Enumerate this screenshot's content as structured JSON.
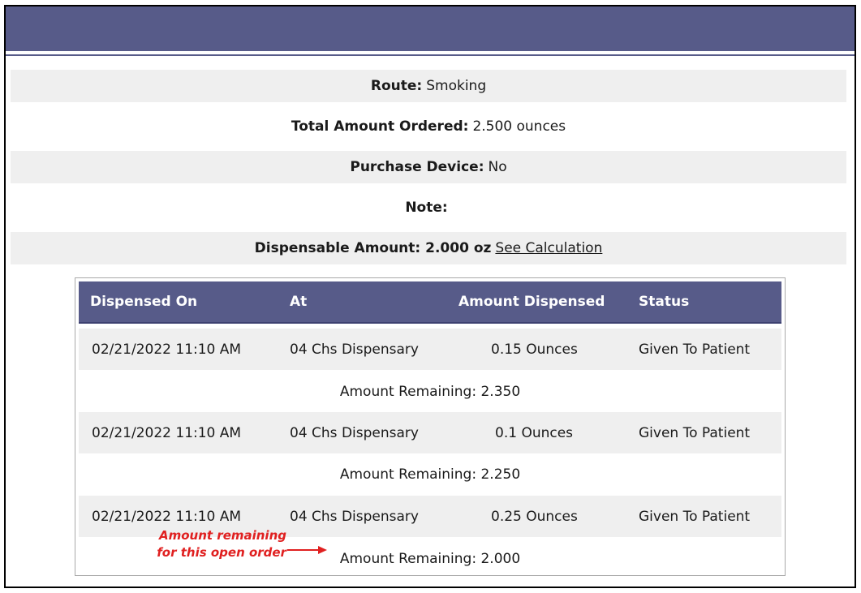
{
  "details": {
    "route_label": "Route:",
    "route_value": "Smoking",
    "total_label": "Total Amount Ordered:",
    "total_value": "2.500 ounces",
    "device_label": "Purchase Device:",
    "device_value": "No",
    "note_label": "Note:",
    "note_value": "",
    "dispensable_text": "Dispensable Amount: 2.000 oz",
    "see_calc_link": "See Calculation"
  },
  "table": {
    "headers": [
      "Dispensed On",
      "At",
      "Amount Dispensed",
      "Status"
    ],
    "rows": [
      {
        "dispensed_on": "02/21/2022 11:10 AM",
        "at": "04 Chs Dispensary",
        "amount": "0.15 Ounces",
        "status": "Given To Patient",
        "remaining": "Amount Remaining: 2.350"
      },
      {
        "dispensed_on": "02/21/2022 11:10 AM",
        "at": "04 Chs Dispensary",
        "amount": "0.1 Ounces",
        "status": "Given To Patient",
        "remaining": "Amount Remaining: 2.250"
      },
      {
        "dispensed_on": "02/21/2022 11:10 AM",
        "at": "04 Chs Dispensary",
        "amount": "0.25 Ounces",
        "status": "Given To Patient",
        "remaining": "Amount Remaining: 2.000"
      }
    ]
  },
  "annotation": {
    "line1": "Amount remaining",
    "line2": "for this open order",
    "color": "#e02020"
  },
  "colors": {
    "header": "#575b89",
    "shaded_row": "#efefef"
  }
}
